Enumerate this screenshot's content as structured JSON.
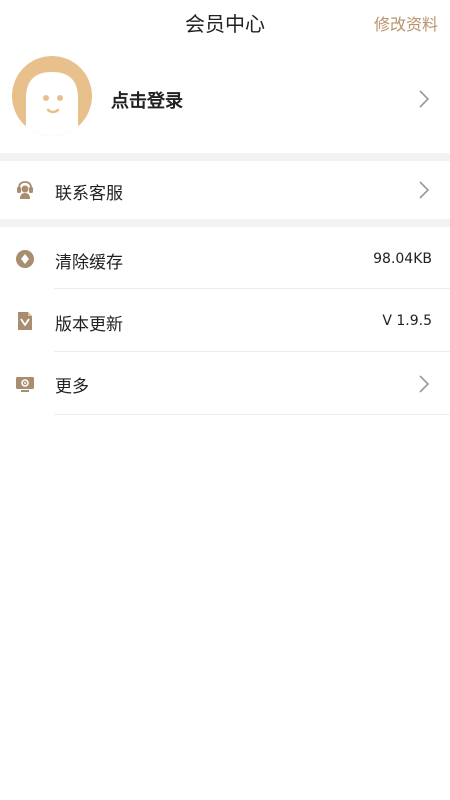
{
  "header": {
    "title": "会员中心",
    "edit_label": "修改资料"
  },
  "profile": {
    "login_label": "点击登录"
  },
  "menu": {
    "contact_label": "联系客服",
    "clear_cache_label": "清除缓存",
    "cache_size": "98.04KB",
    "version_label": "版本更新",
    "version_value": "V 1.9.5",
    "more_label": "更多"
  },
  "colors": {
    "accent": "#b9936a",
    "avatar_bg": "#e8c08b",
    "icon": "#a88d6e"
  },
  "icons": {
    "contact": "customer-service-icon",
    "cache": "coin-icon",
    "version": "update-icon",
    "more": "settings-screen-icon",
    "chevron": "chevron-right-icon"
  }
}
